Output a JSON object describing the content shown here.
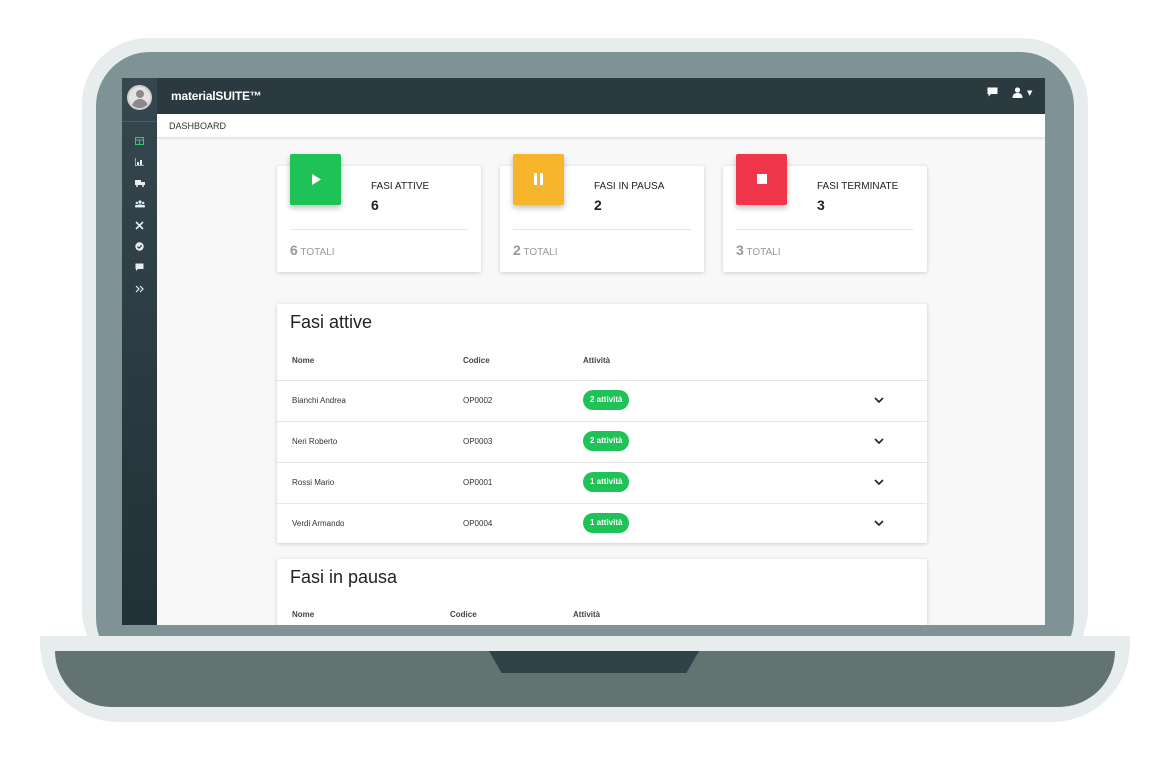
{
  "app": {
    "brand": "materialSUITE™"
  },
  "breadcrumb": "DASHBOARD",
  "colors": {
    "green": "#1ec256",
    "yellow": "#f7b52c",
    "red": "#f0364a",
    "topbar": "#2b3940"
  },
  "sidebar": {
    "icons": [
      "dashboard-icon",
      "chart-icon",
      "truck-icon",
      "users-icon",
      "tools-icon",
      "check-icon",
      "chat-icon",
      "double-chevron-icon"
    ]
  },
  "stats": [
    {
      "title": "FASI ATTIVE",
      "value": "6",
      "total_num": "6",
      "total_label": "TOTALI",
      "icon": "play-icon"
    },
    {
      "title": "FASI IN PAUSA",
      "value": "2",
      "total_num": "2",
      "total_label": "TOTALI",
      "icon": "pause-icon"
    },
    {
      "title": "FASI TERMINATE",
      "value": "3",
      "total_num": "3",
      "total_label": "TOTALI",
      "icon": "stop-icon"
    }
  ],
  "active_table": {
    "title": "Fasi attive",
    "columns": [
      "Nome",
      "Codice",
      "Attività"
    ],
    "rows": [
      {
        "name": "Bianchi Andrea",
        "code": "OP0002",
        "activity": "2 attività"
      },
      {
        "name": "Neri Roberto",
        "code": "OP0003",
        "activity": "2 attività"
      },
      {
        "name": "Rossi Mario",
        "code": "OP0001",
        "activity": "1 attività"
      },
      {
        "name": "Verdi Armando",
        "code": "OP0004",
        "activity": "1 attività"
      }
    ]
  },
  "paused_table": {
    "title": "Fasi in pausa",
    "columns": [
      "Nome",
      "Codice",
      "Attività"
    ]
  }
}
